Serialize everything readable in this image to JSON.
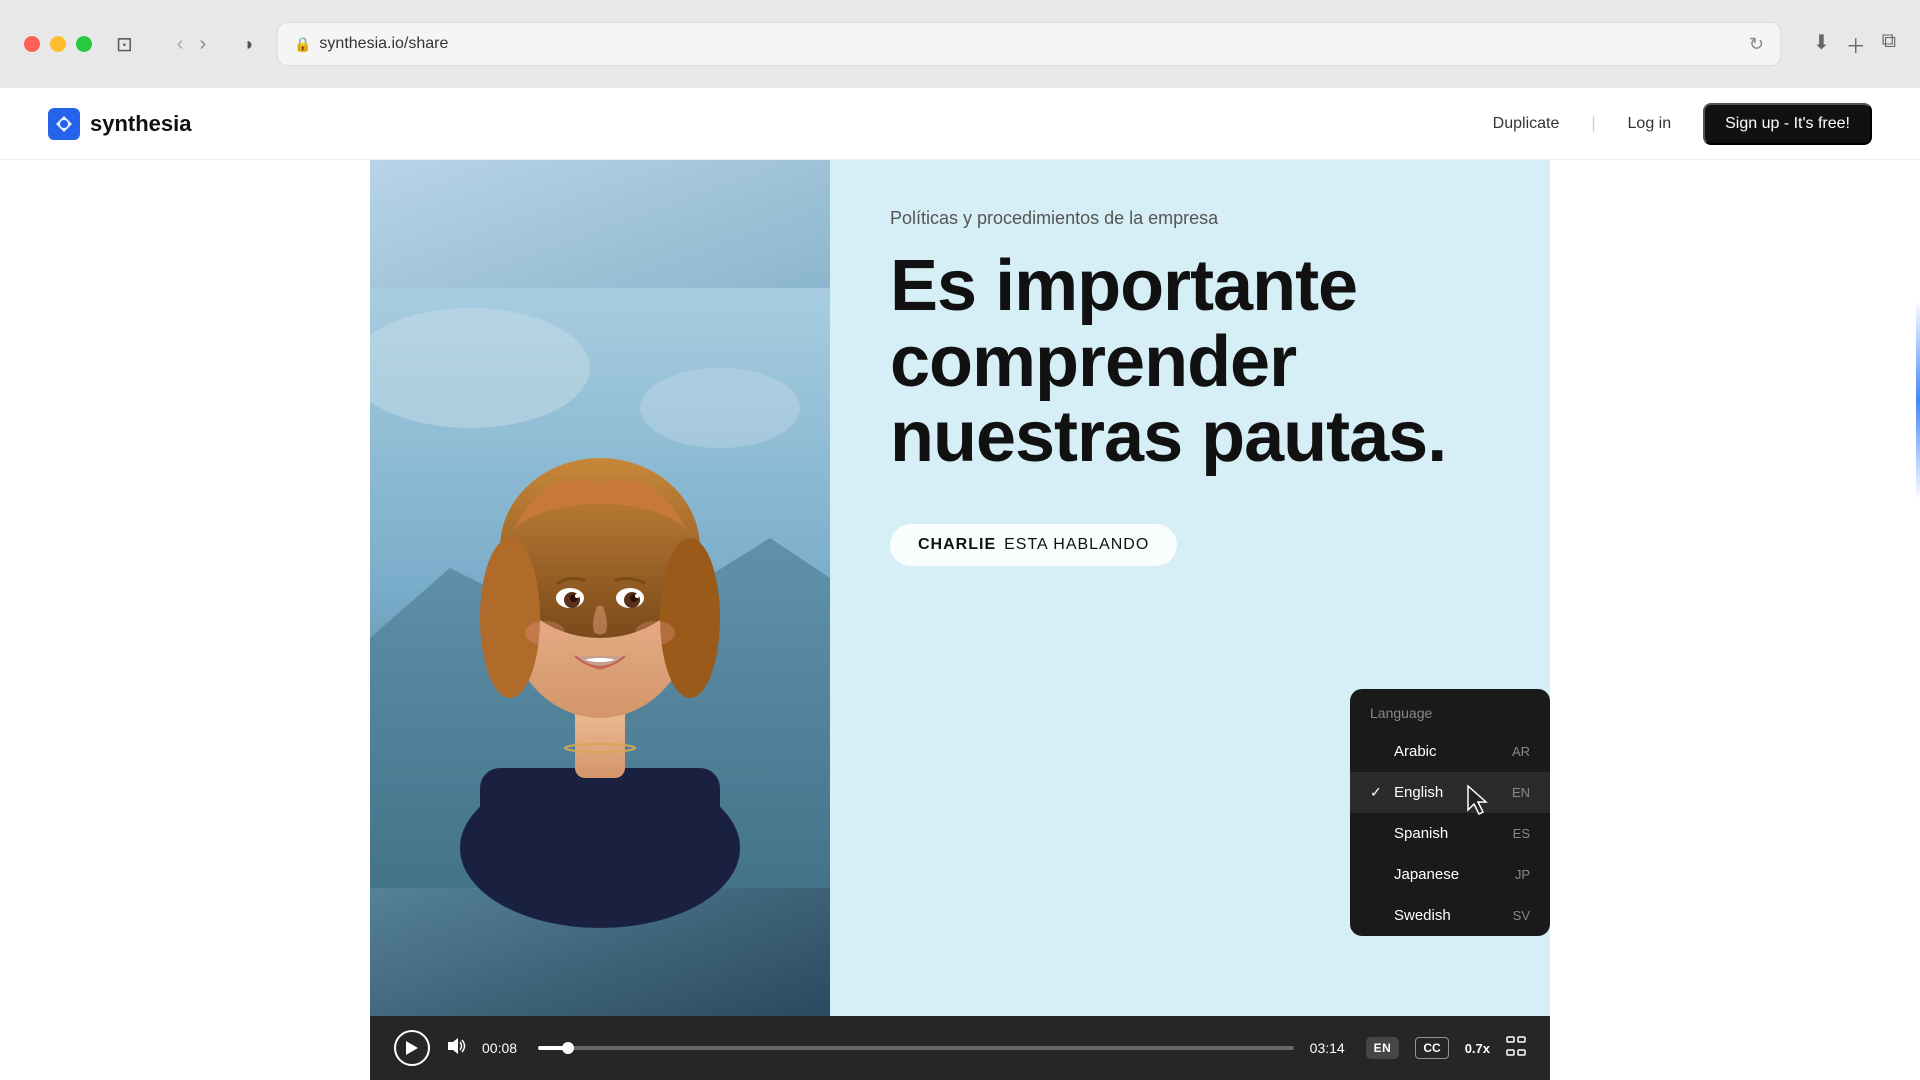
{
  "browser": {
    "url": "synthesia.io/share",
    "url_display": "synthesia.io/share"
  },
  "nav": {
    "logo_text": "synthesia",
    "duplicate_label": "Duplicate",
    "login_label": "Log in",
    "signup_label": "Sign up - It's free!"
  },
  "slide": {
    "subtitle": "Políticas y procedimientos de la empresa",
    "title": "Es importante comprender nuestras pautas.",
    "speaker_prefix": "CHARLIE",
    "speaker_suffix": " ESTA HABLANDO"
  },
  "language_dropdown": {
    "header": "Language",
    "items": [
      {
        "name": "Arabic",
        "code": "AR",
        "active": false
      },
      {
        "name": "English",
        "code": "EN",
        "active": true
      },
      {
        "name": "Spanish",
        "code": "ES",
        "active": false
      },
      {
        "name": "Japanese",
        "code": "JP",
        "active": false
      },
      {
        "name": "Swedish",
        "code": "SV",
        "active": false
      }
    ]
  },
  "video_controls": {
    "current_time": "00:08",
    "total_time": "03:14",
    "language_badge": "EN",
    "cc_label": "CC",
    "speed_label": "0.7x"
  }
}
